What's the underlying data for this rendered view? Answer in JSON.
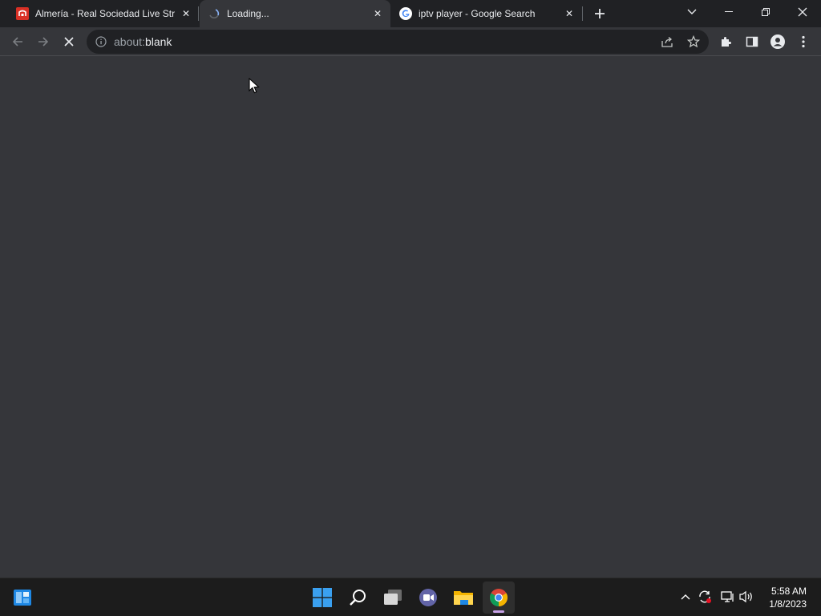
{
  "tabs": [
    {
      "title": "Almería - Real Sociedad Live Stre",
      "favicon": "red-stream-site-icon",
      "active": false
    },
    {
      "title": "Loading...",
      "favicon": "loading-spinner-icon",
      "active": true
    },
    {
      "title": "iptv player - Google Search",
      "favicon": "google-g-icon",
      "active": false
    }
  ],
  "address_bar": {
    "prefix": "about:",
    "host": "blank"
  },
  "taskbar": {
    "apps": [
      "start-icon",
      "search-icon",
      "task-view-icon",
      "teams-chat-icon",
      "file-explorer-icon",
      "chrome-icon"
    ]
  },
  "clock": {
    "time": "5:58 AM",
    "date": "1/8/2023"
  },
  "colors": {
    "accent": "#8ab4f8",
    "tab_strip": "#202124",
    "toolbar": "#35363a"
  }
}
